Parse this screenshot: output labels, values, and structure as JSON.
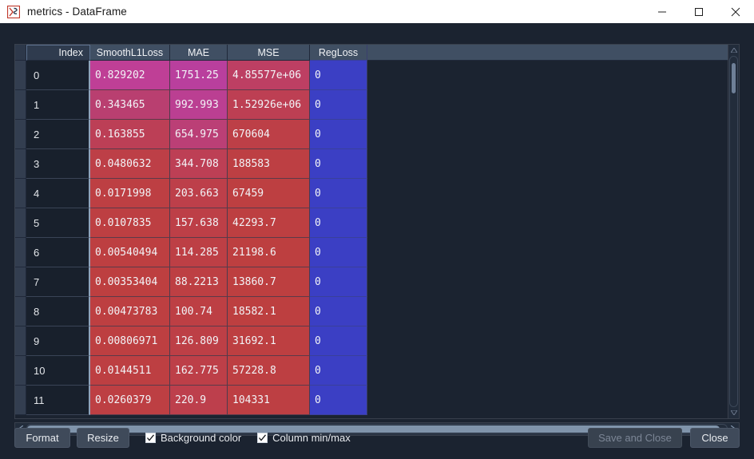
{
  "window": {
    "title": "metrics - DataFrame",
    "icon": "spyder-dataframe-icon",
    "controls": {
      "minimize": "minimize-icon",
      "maximize": "maximize-icon",
      "close": "close-icon"
    }
  },
  "table": {
    "index_header": "Index",
    "columns": [
      "SmoothL1Loss",
      "MAE",
      "MSE",
      "RegLoss"
    ],
    "rows": [
      {
        "index": "0",
        "SmoothL1Loss": "0.829202",
        "MAE": "1751.25",
        "MSE": "4.85577e+06",
        "RegLoss": "0"
      },
      {
        "index": "1",
        "SmoothL1Loss": "0.343465",
        "MAE": "992.993",
        "MSE": "1.52926e+06",
        "RegLoss": "0"
      },
      {
        "index": "2",
        "SmoothL1Loss": "0.163855",
        "MAE": "654.975",
        "MSE": "670604",
        "RegLoss": "0"
      },
      {
        "index": "3",
        "SmoothL1Loss": "0.0480632",
        "MAE": "344.708",
        "MSE": "188583",
        "RegLoss": "0"
      },
      {
        "index": "4",
        "SmoothL1Loss": "0.0171998",
        "MAE": "203.663",
        "MSE": "67459",
        "RegLoss": "0"
      },
      {
        "index": "5",
        "SmoothL1Loss": "0.0107835",
        "MAE": "157.638",
        "MSE": "42293.7",
        "RegLoss": "0"
      },
      {
        "index": "6",
        "SmoothL1Loss": "0.00540494",
        "MAE": "114.285",
        "MSE": "21198.6",
        "RegLoss": "0"
      },
      {
        "index": "7",
        "SmoothL1Loss": "0.00353404",
        "MAE": "88.2213",
        "MSE": "13860.7",
        "RegLoss": "0"
      },
      {
        "index": "8",
        "SmoothL1Loss": "0.00473783",
        "MAE": "100.74",
        "MSE": "18582.1",
        "RegLoss": "0"
      },
      {
        "index": "9",
        "SmoothL1Loss": "0.00806971",
        "MAE": "126.809",
        "MSE": "31692.1",
        "RegLoss": "0"
      },
      {
        "index": "10",
        "SmoothL1Loss": "0.0144511",
        "MAE": "162.775",
        "MSE": "57228.8",
        "RegLoss": "0"
      },
      {
        "index": "11",
        "SmoothL1Loss": "0.0260379",
        "MAE": "220.9",
        "MSE": "104331",
        "RegLoss": "0"
      }
    ],
    "cell_colors": [
      {
        "SmoothL1Loss": "#bf3f96",
        "MAE": "#b93f9d",
        "MSE": "#bd3f63",
        "RegLoss": "#3b3fc4"
      },
      {
        "SmoothL1Loss": "#b93f70",
        "MAE": "#bb3f92",
        "MSE": "#bd3f53",
        "RegLoss": "#3b3fc4"
      },
      {
        "SmoothL1Loss": "#bc3f56",
        "MAE": "#bb3f76",
        "MSE": "#bd3f47",
        "RegLoss": "#3b3fc4"
      },
      {
        "SmoothL1Loss": "#bd3f47",
        "MAE": "#bd3f55",
        "MSE": "#bd3f43",
        "RegLoss": "#3b3fc4"
      },
      {
        "SmoothL1Loss": "#bd3f43",
        "MAE": "#bd3f4a",
        "MSE": "#bd3f41",
        "RegLoss": "#3b3fc4"
      },
      {
        "SmoothL1Loss": "#bd3f42",
        "MAE": "#bd3f47",
        "MSE": "#bd3f41",
        "RegLoss": "#3b3fc4"
      },
      {
        "SmoothL1Loss": "#bd3f41",
        "MAE": "#bd3f45",
        "MSE": "#bd3f40",
        "RegLoss": "#3b3fc4"
      },
      {
        "SmoothL1Loss": "#bd3f40",
        "MAE": "#bd3f43",
        "MSE": "#bd3f40",
        "RegLoss": "#3b3fc4"
      },
      {
        "SmoothL1Loss": "#bd3f41",
        "MAE": "#bd3f44",
        "MSE": "#bd3f40",
        "RegLoss": "#3b3fc4"
      },
      {
        "SmoothL1Loss": "#bd3f41",
        "MAE": "#bd3f46",
        "MSE": "#bd3f41",
        "RegLoss": "#3b3fc4"
      },
      {
        "SmoothL1Loss": "#bd3f42",
        "MAE": "#bd3f48",
        "MSE": "#bd3f42",
        "RegLoss": "#3b3fc4"
      },
      {
        "SmoothL1Loss": "#bd3f43",
        "MAE": "#bd3f4c",
        "MSE": "#bd3f43",
        "RegLoss": "#3b3fc4"
      }
    ]
  },
  "scrollbars": {
    "vertical": {
      "thumb_position_pct": 2,
      "thumb_size_pct": 9
    },
    "horizontal": {
      "thumb_position_pct": 0,
      "thumb_size_pct": 99
    }
  },
  "footer": {
    "format_label": "Format",
    "resize_label": "Resize",
    "background_color_label": "Background color",
    "background_color_checked": true,
    "column_minmax_label": "Column min/max",
    "column_minmax_checked": true,
    "save_and_close_label": "Save and Close",
    "save_and_close_enabled": false,
    "close_label": "Close",
    "close_enabled": true
  },
  "colors": {
    "window_bg": "#1b2330",
    "header_bg": "#404f63",
    "index_bg": "#18202c",
    "accent_blue": "#3b3fc4",
    "accent_magenta": "#bf3f96",
    "accent_red": "#bd3f41"
  }
}
